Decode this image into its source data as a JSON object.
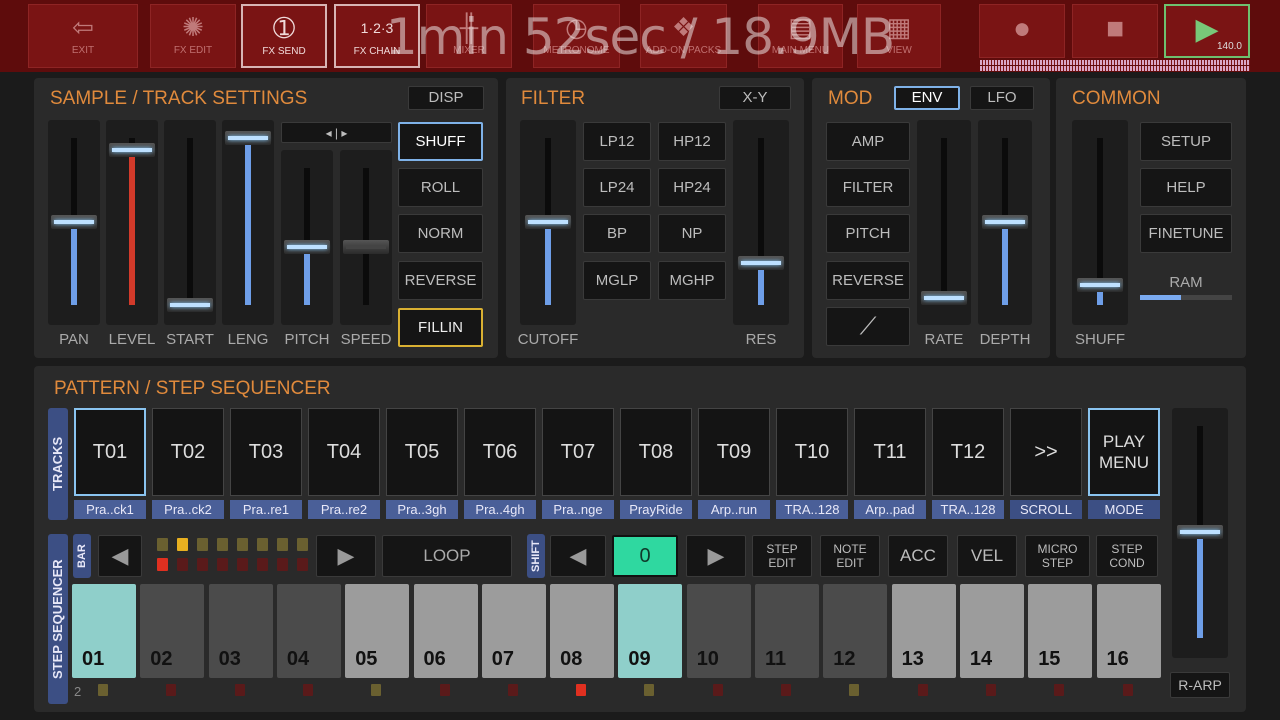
{
  "topbar": {
    "buttons": [
      {
        "label": "EXIT",
        "icon": "exit-icon",
        "glyph": "⇦"
      },
      {
        "label": "FX EDIT",
        "icon": "fx-edit-icon",
        "glyph": "✺"
      },
      {
        "label": "FX SEND",
        "icon": "fx-send-icon",
        "glyph": "➀"
      },
      {
        "label": "FX CHAIN",
        "icon": "fx-chain-icon",
        "glyph": "1·2·3"
      },
      {
        "label": "MIXER",
        "icon": "mixer-icon",
        "glyph": "╫"
      },
      {
        "label": "METRONOME",
        "icon": "metronome-icon",
        "glyph": "◷"
      },
      {
        "label": "ADD-ON PACKS",
        "icon": "add-on-packs-icon",
        "glyph": "❖"
      },
      {
        "label": "MAIN MENU",
        "icon": "main-menu-icon",
        "glyph": "▤"
      },
      {
        "label": "VIEW",
        "icon": "view-icon",
        "glyph": "▦"
      }
    ],
    "record_glyph": "●",
    "stop_glyph": "■",
    "play_glyph": "▶",
    "tempo": "140.0",
    "overlay": "1min 52sec / 18.9MB"
  },
  "sample": {
    "title": "SAMPLE / TRACK SETTINGS",
    "disp": "DISP",
    "faders": [
      {
        "label": "PAN",
        "value": 0.5
      },
      {
        "label": "LEVEL",
        "value": 0.93,
        "red": true
      },
      {
        "label": "START",
        "value": 0.0
      },
      {
        "label": "LENG",
        "value": 1.0
      },
      {
        "label": "PITCH",
        "value": 0.42
      },
      {
        "label": "SPEED",
        "value": 0.42,
        "dim": true
      }
    ],
    "direction": "◂ | ▸",
    "buttons": [
      "SHUFF",
      "ROLL",
      "NORM",
      "REVERSE",
      "FILLIN"
    ]
  },
  "filter": {
    "title": "FILTER",
    "xy": "X-Y",
    "cutoff": {
      "label": "CUTOFF",
      "value": 0.5
    },
    "res": {
      "label": "RES",
      "value": 0.25
    },
    "types": [
      "LP12",
      "HP12",
      "LP24",
      "HP24",
      "BP",
      "NP",
      "MGLP",
      "MGHP"
    ]
  },
  "mod": {
    "title": "MOD",
    "env": "ENV",
    "lfo": "LFO",
    "buttons": [
      "AMP",
      "FILTER",
      "PITCH",
      "REVERSE"
    ],
    "shape_glyph": "⟋",
    "rate": {
      "label": "RATE",
      "value": 0.04
    },
    "depth": {
      "label": "DEPTH",
      "value": 0.5
    }
  },
  "common": {
    "title": "COMMON",
    "shuff": {
      "label": "SHUFF",
      "value": 0.12
    },
    "buttons": [
      "SETUP",
      "HELP",
      "FINETUNE"
    ],
    "ram_label": "RAM",
    "ram_value": 0.45
  },
  "pattern": {
    "title": "PATTERN / STEP SEQUENCER",
    "tracks_label": "TRACKS",
    "tracks": [
      {
        "label": "T01",
        "name": "Pra..ck1"
      },
      {
        "label": "T02",
        "name": "Pra..ck2"
      },
      {
        "label": "T03",
        "name": "Pra..re1"
      },
      {
        "label": "T04",
        "name": "Pra..re2"
      },
      {
        "label": "T05",
        "name": "Pra..3gh"
      },
      {
        "label": "T06",
        "name": "Pra..4gh"
      },
      {
        "label": "T07",
        "name": "Pra..nge"
      },
      {
        "label": "T08",
        "name": "PrayRide"
      },
      {
        "label": "T09",
        "name": "Arp..run"
      },
      {
        "label": "T10",
        "name": "TRA..128"
      },
      {
        "label": "T11",
        "name": "Arp..pad"
      },
      {
        "label": "T12",
        "name": "TRA..128"
      },
      {
        "label": ">>",
        "name": "SCROLL"
      },
      {
        "label": "PLAY MENU",
        "name": "MODE"
      }
    ],
    "seq_label": "STEP SEQUENCER",
    "bar_label": "BAR",
    "loop": "LOOP",
    "shift_label": "SHIFT",
    "shift_value": "0",
    "prev": "◀",
    "next": "▶",
    "edit_buttons": [
      "STEP EDIT",
      "NOTE EDIT",
      "ACC",
      "VEL",
      "MICRO STEP",
      "STEP COND"
    ],
    "steps": [
      {
        "num": "01",
        "state": "active"
      },
      {
        "num": "02",
        "state": "dark"
      },
      {
        "num": "03",
        "state": "dark"
      },
      {
        "num": "04",
        "state": "dark"
      },
      {
        "num": "05",
        "state": "light"
      },
      {
        "num": "06",
        "state": "light"
      },
      {
        "num": "07",
        "state": "light"
      },
      {
        "num": "08",
        "state": "light"
      },
      {
        "num": "09",
        "state": "active"
      },
      {
        "num": "10",
        "state": "dark"
      },
      {
        "num": "11",
        "state": "dark"
      },
      {
        "num": "12",
        "state": "dark"
      },
      {
        "num": "13",
        "state": "light"
      },
      {
        "num": "14",
        "state": "light"
      },
      {
        "num": "15",
        "state": "light"
      },
      {
        "num": "16",
        "state": "light"
      }
    ],
    "bar_number": "2",
    "indicators": [
      "yellow",
      "red",
      "red",
      "red",
      "yellow",
      "red",
      "red",
      "bright-red",
      "yellow",
      "red",
      "red",
      "yellow",
      "red",
      "red",
      "red",
      "red"
    ],
    "master_value": 0.5,
    "rarp": "R-ARP"
  },
  "colors": {
    "accent": "#e08a3c",
    "active_step": "#8fcfca",
    "dark_step": "#4b4b4b",
    "light_step": "#9c9c9c",
    "shift": "#2fd8a0",
    "track_name": "#4a5f98"
  }
}
